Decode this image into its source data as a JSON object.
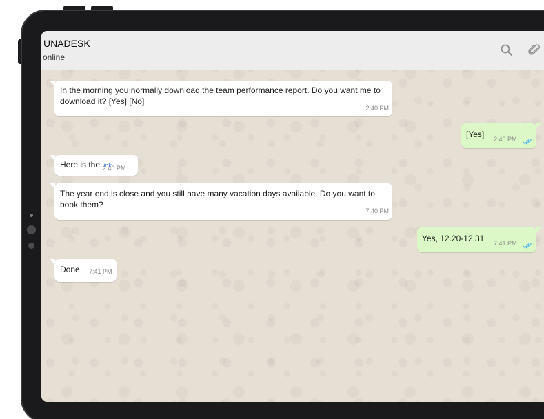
{
  "header": {
    "contact_name": "UNADESK",
    "status": "online",
    "search_icon": "search-icon",
    "attach_icon": "paperclip-icon"
  },
  "colors": {
    "chat_background": "#e6dfd4",
    "header_background": "#ededed",
    "incoming_bubble": "#ffffff",
    "outgoing_bubble": "#dcf8c6",
    "read_ticks": "#4fb6ec",
    "link": "#3b7fd6"
  },
  "messages": [
    {
      "direction": "incoming",
      "text": "In the morning you normally download the team performance report. Do you want me to download it? [Yes] [No]",
      "time": "2:40 PM"
    },
    {
      "direction": "outgoing",
      "text": "[Yes]",
      "time": "2:40 PM",
      "status": "read"
    },
    {
      "direction": "incoming",
      "text": "Here is the",
      "link_text": "link",
      "time": "2:40 PM"
    },
    {
      "direction": "incoming",
      "text": "The year end is close and you still have many vacation days available. Do you want to book them?",
      "time": "7:40 PM"
    },
    {
      "direction": "outgoing",
      "text": "Yes, 12.20-12.31",
      "time": "7:41 PM",
      "status": "read"
    },
    {
      "direction": "incoming",
      "text": "Done",
      "time": "7:41 PM"
    }
  ]
}
